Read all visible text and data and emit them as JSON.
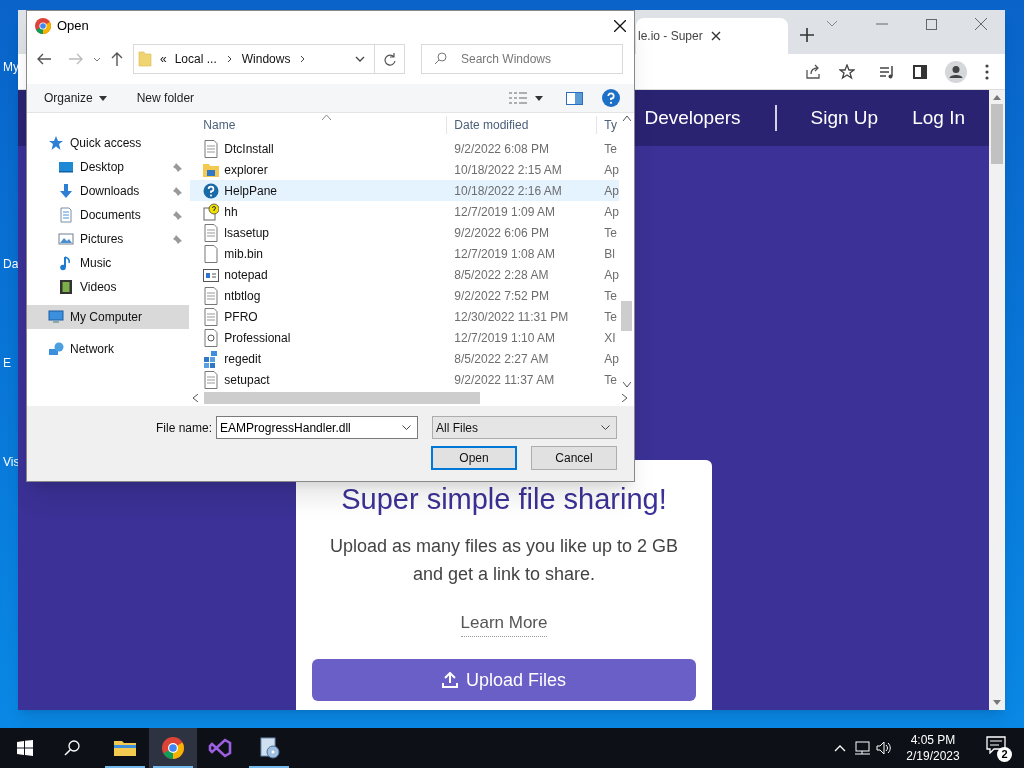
{
  "desktop_icons": [
    {
      "label": "My"
    },
    {
      "label": "Da"
    },
    {
      "label": "E"
    },
    {
      "label": "Vis"
    }
  ],
  "browser": {
    "tab": {
      "title": "le.io - Super"
    },
    "nav": [
      {
        "label": "Developers"
      },
      {
        "label": "Sign Up"
      },
      {
        "label": "Log In"
      }
    ],
    "card": {
      "heading": "Super simple file sharing!",
      "text": "Upload as many files as you like up to 2 GB and get a link to share.",
      "link": "Learn More",
      "button": "Upload Files"
    }
  },
  "dialog": {
    "title": "Open",
    "breadcrumb": [
      "«",
      "Local ...",
      "Windows"
    ],
    "search": {
      "placeholder": "Search Windows"
    },
    "commands": [
      "Organize",
      "New folder"
    ],
    "sidebar": [
      {
        "label": "Quick access",
        "kind": "star",
        "pinned": false,
        "selected": false,
        "children": [
          {
            "label": "Desktop",
            "kind": "desktop",
            "pinned": true,
            "selected": false
          },
          {
            "label": "Downloads",
            "kind": "download",
            "pinned": true,
            "selected": false
          },
          {
            "label": "Documents",
            "kind": "documents",
            "pinned": true,
            "selected": false
          },
          {
            "label": "Pictures",
            "kind": "pictures",
            "pinned": true,
            "selected": false
          },
          {
            "label": "Music",
            "kind": "music",
            "pinned": false,
            "selected": false
          },
          {
            "label": "Videos",
            "kind": "videos",
            "pinned": false,
            "selected": false
          }
        ]
      },
      {
        "label": "My Computer",
        "kind": "computer",
        "pinned": false,
        "selected": true
      },
      {
        "label": "Network",
        "kind": "network",
        "pinned": false,
        "selected": false
      }
    ],
    "columns": [
      "Name",
      "Date modified",
      "Ty"
    ],
    "rows": [
      {
        "name": "DtcInstall",
        "date": "9/2/2022 6:08 PM",
        "type": "Te",
        "kind": "text",
        "hovered": false
      },
      {
        "name": "explorer",
        "date": "10/18/2022 2:15 AM",
        "type": "Ap",
        "kind": "folder",
        "hovered": false
      },
      {
        "name": "HelpPane",
        "date": "10/18/2022 2:16 AM",
        "type": "Ap",
        "kind": "help",
        "hovered": true
      },
      {
        "name": "hh",
        "date": "12/7/2019 1:09 AM",
        "type": "Ap",
        "kind": "helpdoc",
        "hovered": false
      },
      {
        "name": "lsasetup",
        "date": "9/2/2022 6:06 PM",
        "type": "Te",
        "kind": "text",
        "hovered": false
      },
      {
        "name": "mib.bin",
        "date": "12/7/2019 1:08 AM",
        "type": "Bl",
        "kind": "blank",
        "hovered": false
      },
      {
        "name": "notepad",
        "date": "8/5/2022 2:28 AM",
        "type": "Ap",
        "kind": "window",
        "hovered": false
      },
      {
        "name": "ntbtlog",
        "date": "9/2/2022 7:52 PM",
        "type": "Te",
        "kind": "text",
        "hovered": false
      },
      {
        "name": "PFRO",
        "date": "12/30/2022 11:31 PM",
        "type": "Te",
        "kind": "text",
        "hovered": false
      },
      {
        "name": "Professional",
        "date": "12/7/2019 1:10 AM",
        "type": "XI",
        "kind": "config",
        "hovered": false
      },
      {
        "name": "regedit",
        "date": "8/5/2022 2:27 AM",
        "type": "Ap",
        "kind": "cubes",
        "hovered": false
      },
      {
        "name": "setupact",
        "date": "9/2/2022 11:37 AM",
        "type": "Te",
        "kind": "text",
        "hovered": false
      }
    ],
    "file_name": {
      "label": "File name:",
      "value": "EAMProgressHandler.dll"
    },
    "filter": "All Files",
    "buttons": [
      {
        "label": "Open",
        "kind": "default"
      },
      {
        "label": "Cancel",
        "kind": "normal"
      }
    ]
  },
  "taskbar": {
    "apps": [
      {
        "kind": "explorer",
        "running": true,
        "selected": false
      },
      {
        "kind": "chrome",
        "running": true,
        "selected": true
      },
      {
        "kind": "studio",
        "running": false,
        "selected": false
      },
      {
        "kind": "installer",
        "running": true,
        "selected": false
      }
    ],
    "time": "4:05 PM",
    "date": "2/19/2023",
    "notifications": "2"
  }
}
